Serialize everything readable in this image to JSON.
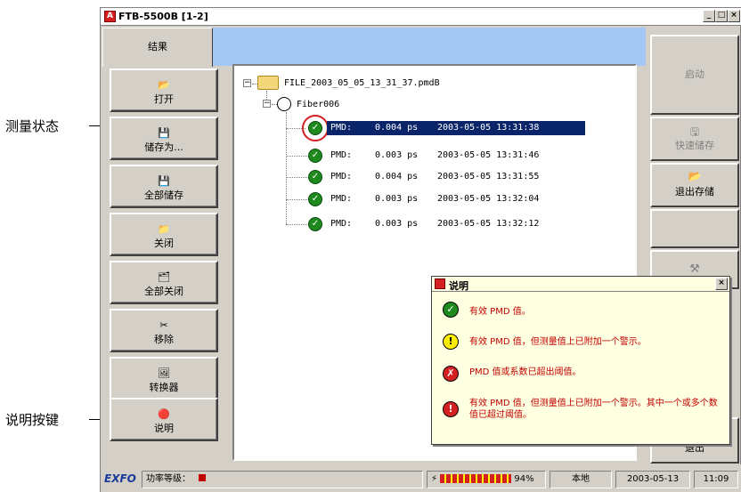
{
  "callouts": {
    "status": "测量状态",
    "legend_button": "说明按键"
  },
  "window": {
    "title": "FTB-5500B [1-2]",
    "min": "_",
    "max": "□",
    "close": "×"
  },
  "tab": {
    "label": "结果"
  },
  "left_buttons": [
    {
      "label": "打开",
      "icon": "open-folder-icon",
      "glyph": "📂"
    },
    {
      "label": "储存为...",
      "icon": "floppy-icon",
      "glyph": "💾"
    },
    {
      "label": "全部储存",
      "icon": "floppy-icon",
      "glyph": "💾"
    },
    {
      "label": "关闭",
      "icon": "folder-icon",
      "glyph": "📁"
    },
    {
      "label": "全部关闭",
      "icon": "folders-icon",
      "glyph": "🗂"
    },
    {
      "label": "移除",
      "icon": "remove-icon",
      "glyph": "✂"
    },
    {
      "label": "转换器",
      "icon": "converter-icon",
      "glyph": "🖼"
    },
    {
      "label": "说明",
      "icon": "legend-icon",
      "glyph": "🔴"
    }
  ],
  "tree": {
    "file_name": "FILE_2003_05_05_13_31_37.pmdB",
    "fiber_name": "Fiber006",
    "rows": [
      {
        "label": "PMD:",
        "value": "0.004 ps",
        "time": "2003-05-05 13:31:38"
      },
      {
        "label": "PMD:",
        "value": "0.003 ps",
        "time": "2003-05-05 13:31:46"
      },
      {
        "label": "PMD:",
        "value": "0.004 ps",
        "time": "2003-05-05 13:31:55"
      },
      {
        "label": "PMD:",
        "value": "0.003 ps",
        "time": "2003-05-05 13:32:04"
      },
      {
        "label": "PMD:",
        "value": "0.003 ps",
        "time": "2003-05-05 13:32:12"
      }
    ]
  },
  "right_buttons": {
    "start": "启动",
    "quick_save": "快速储存",
    "exit_save": "退出存储",
    "exit": "退出"
  },
  "legend": {
    "title": "说明",
    "close": "×",
    "items": [
      "有效 PMD 值。",
      "有效 PMD 值，但测量值上已附加一个警示。",
      "PMD 值或系数已超出阈值。",
      "有效 PMD 值，但测量值上已附加一个警示。其中一个或多个数值已超过阈值。"
    ]
  },
  "status_bar": {
    "brand": "EXFO",
    "power_label": "功率等级：",
    "battery": "94%",
    "mode": "本地",
    "date": "2003-05-13",
    "time": "11:09"
  },
  "colors": {
    "selection": "#0a246a",
    "tab_strip": "#a4c8f4",
    "ok_green": "#1e8a1e",
    "highlight_red": "#d42020"
  }
}
